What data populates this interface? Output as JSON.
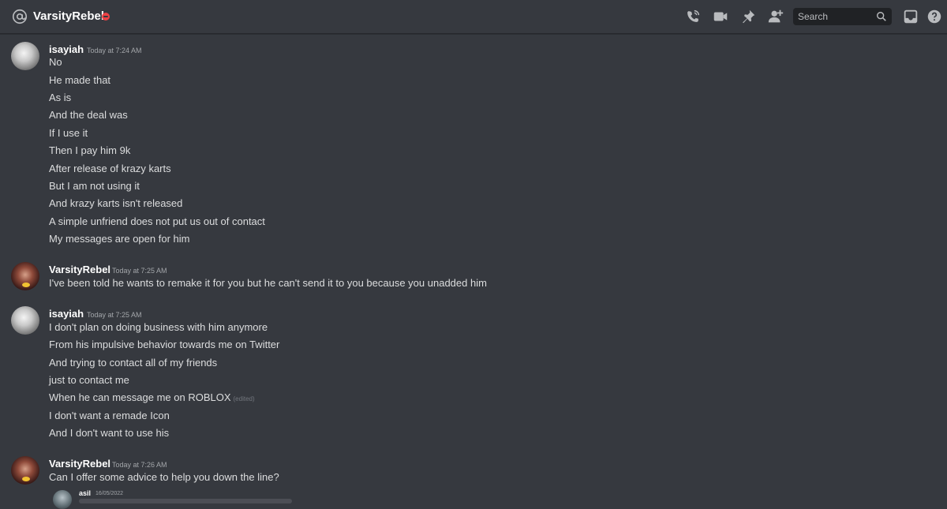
{
  "header": {
    "channel_name": "VarsityRebel",
    "search_placeholder": "Search"
  },
  "messages": [
    {
      "author": "isayiah",
      "timestamp": "Today at 7:24 AM",
      "lines": [
        "No",
        "He made that",
        "As is",
        "And the deal was",
        "If I use it",
        "Then I pay him 9k",
        "After release of krazy karts",
        "But I am not using it",
        "And krazy karts isn't released",
        "A simple unfriend does not put us out of contact",
        "My messages are open for him"
      ]
    },
    {
      "author": "VarsityRebel",
      "timestamp": "Today at 7:25 AM",
      "lines": [
        "I've been told he wants to remake it for you but he can't send it to you because you unadded him"
      ]
    },
    {
      "author": "isayiah",
      "timestamp": "Today at 7:25 AM",
      "lines": [
        "I don't plan on doing business with him anymore",
        "From his impulsive behavior towards me on Twitter",
        "And trying to contact all of my friends",
        "just to contact me",
        "When he can message me on ROBLOX",
        "I don't want a remade Icon",
        "And I don't want to use his"
      ],
      "edited_label": "(edited)"
    },
    {
      "author": "VarsityRebel",
      "timestamp": "Today at 7:26 AM",
      "lines": [
        "Can I offer some advice to help you down the line?"
      ]
    }
  ],
  "reply": {
    "author": "asil",
    "timestamp": "16/05/2022"
  },
  "colors": {
    "background": "#36393f",
    "dnd_status": "#ed4245"
  }
}
